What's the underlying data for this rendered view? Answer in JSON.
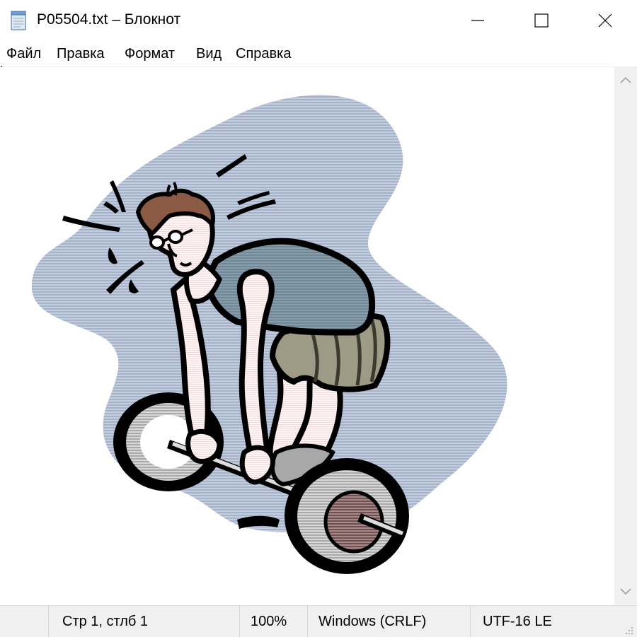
{
  "window": {
    "title": "P05504.txt – Блокнот",
    "controls": [
      "minimize",
      "maximize",
      "close"
    ]
  },
  "menu": {
    "items": [
      "Файл",
      "Правка",
      "Формат",
      "Вид",
      "Справка"
    ]
  },
  "editor": {
    "content_description": "clipart weightlifter icon",
    "colors": {
      "background_blob": "#a4b3ca",
      "shirt": "#6f8796",
      "hair": "#8a5a44",
      "skin": "#fff2f2",
      "outline": "#000000",
      "plate": "#bcbcbc"
    }
  },
  "status": {
    "position": "Стр 1, стлб 1",
    "zoom": "100%",
    "line_endings": "Windows (CRLF)",
    "encoding": "UTF-16 LE"
  }
}
